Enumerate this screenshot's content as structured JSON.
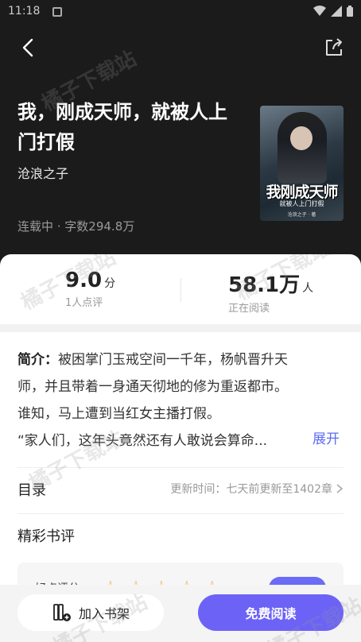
{
  "status_bar": {
    "time": "11:18"
  },
  "book": {
    "title": "我，刚成天师，就被人上门打假",
    "author": "沧浪之子",
    "meta": "连载中 · 字数294.8万",
    "cover": {
      "title": "我刚成天师",
      "subtitle": "就被人上门打假",
      "author": "沧浪之子 · 著"
    }
  },
  "watermark": "橘子下载站",
  "stats": {
    "rating": {
      "value": "9.0",
      "unit": "分",
      "label": "1人点评"
    },
    "readers": {
      "value": "58.1万",
      "unit": "人",
      "label": "正在阅读"
    }
  },
  "intro": {
    "label": "简介：",
    "lines": [
      "被困掌门玉戒空间一千年，杨帆晋升天",
      "师，并且带着一身通天彻地的修为重返都市。",
      "谁知，马上遭到当红女主播打假。",
      "“家人们，这年头竟然还有人敢说会算命..."
    ],
    "expand_label": "展开"
  },
  "toc": {
    "title": "目录",
    "update_text": "更新时间：七天前更新至1402章"
  },
  "comments": {
    "title": "精彩书评",
    "rate_label": "好点评分",
    "stars": 5
  },
  "bottom": {
    "shelf_label": "加入书架",
    "read_label": "免费阅读"
  },
  "colors": {
    "accent": "#6c63f6",
    "link": "#5b6cf5",
    "star": "#f5a623"
  }
}
